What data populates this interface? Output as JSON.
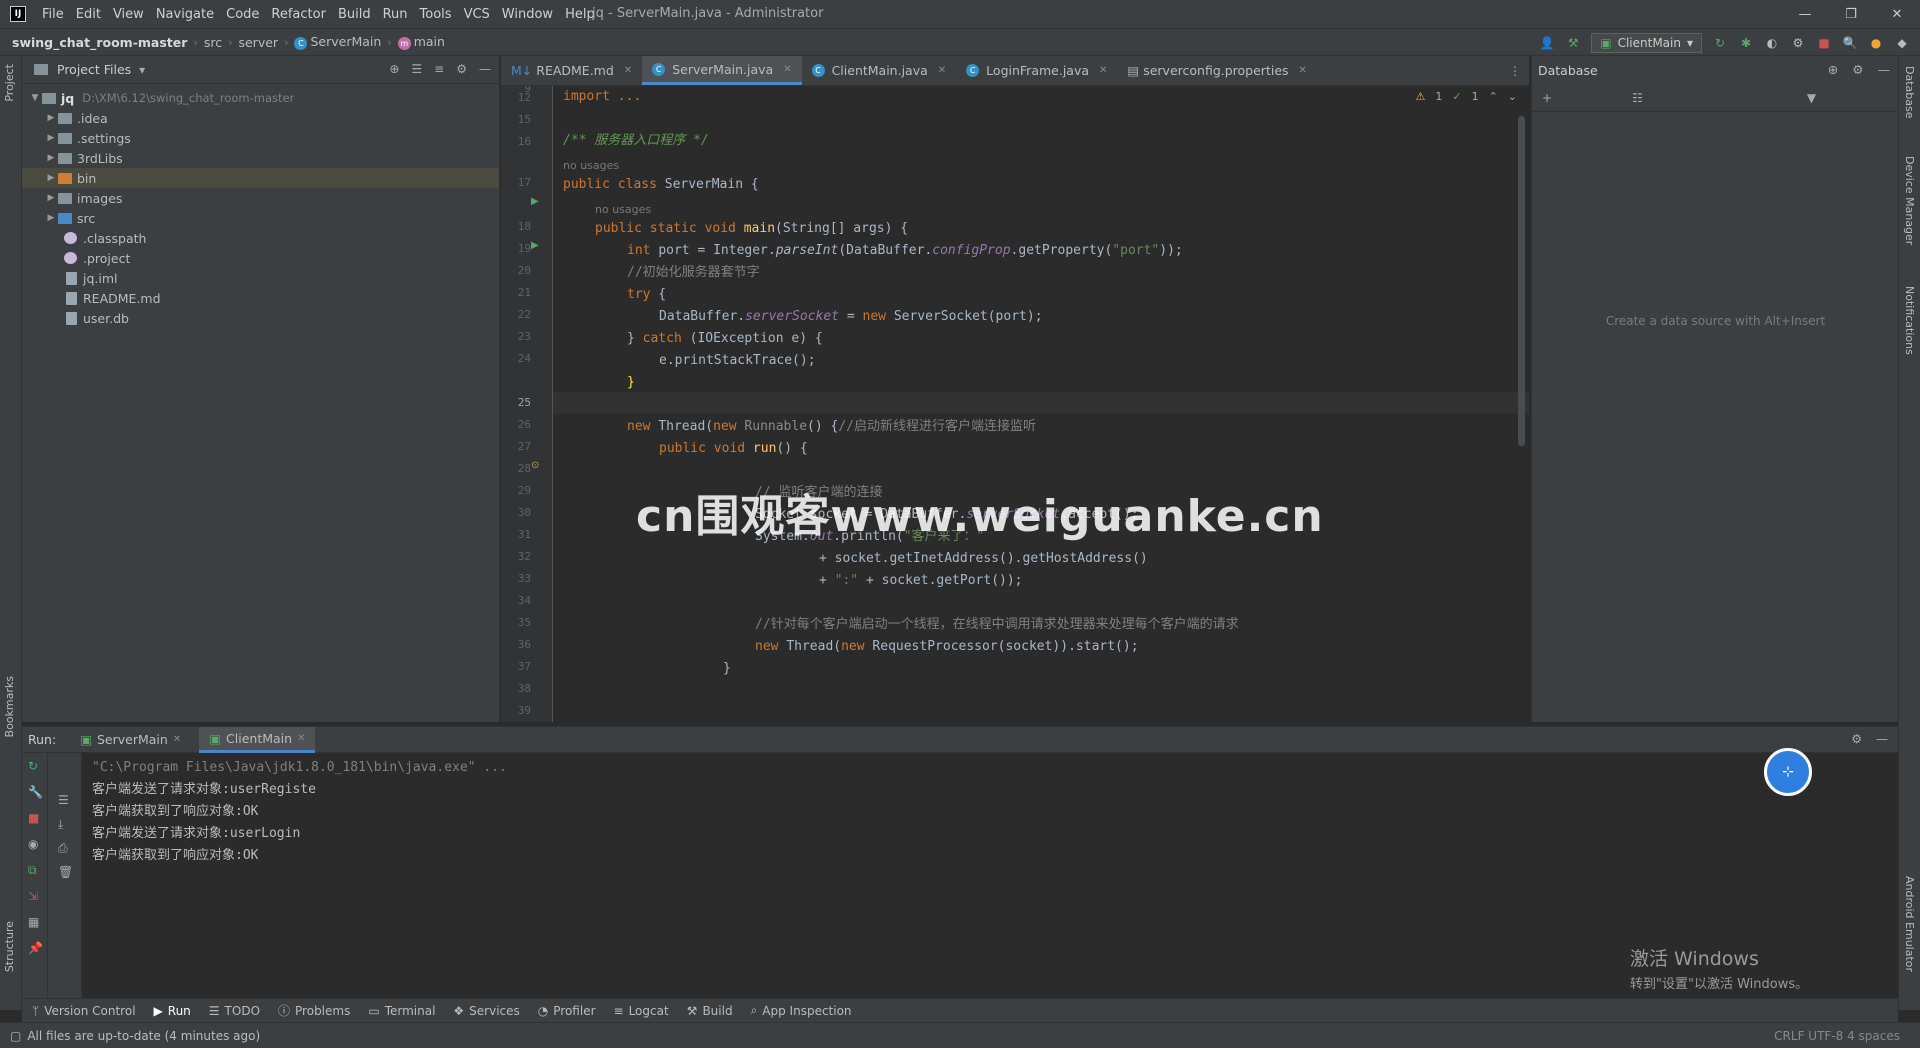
{
  "titlebar": {
    "logo": "IJ",
    "menu": [
      "File",
      "Edit",
      "View",
      "Navigate",
      "Code",
      "Refactor",
      "Build",
      "Run",
      "Tools",
      "VCS",
      "Window",
      "Help"
    ],
    "window_title": "jq - ServerMain.java - Administrator",
    "controls": [
      "—",
      "❐",
      "✕"
    ]
  },
  "navbar": {
    "crumbs": [
      "swing_chat_room-master",
      "src",
      "server",
      "ServerMain",
      "main"
    ],
    "run_config": "ClientMain"
  },
  "left_strip": {
    "project": "Project",
    "bookmarks": "Bookmarks",
    "structure": "Structure"
  },
  "right_strip": {
    "database": "Database",
    "device_manager": "Device Manager",
    "notifications": "Notifications",
    "android_emulator": "Android Emulator"
  },
  "project_panel": {
    "title": "Project Files",
    "tree": [
      {
        "label": "jq",
        "hint": "D:\\XM\\6.12\\swing_chat_room-master",
        "kind": "root",
        "expanded": true
      },
      {
        "label": ".idea",
        "kind": "folder"
      },
      {
        "label": ".settings",
        "kind": "folder"
      },
      {
        "label": "3rdLibs",
        "kind": "folder"
      },
      {
        "label": "bin",
        "kind": "folder-orange",
        "selected": true
      },
      {
        "label": "images",
        "kind": "folder"
      },
      {
        "label": "src",
        "kind": "folder-blue"
      },
      {
        "label": ".classpath",
        "kind": "file-circle"
      },
      {
        "label": ".project",
        "kind": "file-circle"
      },
      {
        "label": "jq.iml",
        "kind": "file"
      },
      {
        "label": "README.md",
        "kind": "file"
      },
      {
        "label": "user.db",
        "kind": "file"
      }
    ]
  },
  "editor": {
    "tabs": [
      {
        "label": "README.md",
        "icon": "md-icon"
      },
      {
        "label": "ServerMain.java",
        "icon": "class-icon",
        "active": true
      },
      {
        "label": "ClientMain.java",
        "icon": "class-icon"
      },
      {
        "label": "LoginFrame.java",
        "icon": "class-icon"
      },
      {
        "label": "serverconfig.properties",
        "icon": "properties-icon"
      }
    ],
    "inspection": {
      "warnings": "1",
      "weak": "1"
    },
    "line_numbers": [
      "9",
      "12",
      "15",
      "16",
      "17",
      "",
      "18",
      "19",
      "20",
      "21",
      "22",
      "23",
      "24",
      "25",
      "26",
      "27",
      "28",
      "29",
      "30",
      "31",
      "32",
      "33",
      "34",
      "35",
      "36",
      "37",
      "38",
      "39"
    ],
    "current_line": "25",
    "hints": {
      "no_usages_1": "no usages",
      "no_usages_2": "no usages"
    },
    "lines": {
      "l1": "import ...",
      "l2": "/** 服务器入口程序 */",
      "l3a": "public class ",
      "l3b": "ServerMain {",
      "l4a": "public static void ",
      "l4b": "main",
      "l4c": "(String[] args) {",
      "l5a": "int ",
      "l5b": "port = Integer.",
      "l5c": "parseInt",
      "l5d": "(DataBuffer.",
      "l5e": "configProp",
      "l5f": ".getProperty(",
      "l5g": "\"port\"",
      "l5h": "));",
      "l6": "//初始化服务器套节字",
      "l7a": "try",
      "l7b": " {",
      "l8a": "DataBuffer.",
      "l8b": "serverSocket",
      "l8c": " = ",
      "l8d": "new ",
      "l8e": "ServerSocket(port);",
      "l9a": "} ",
      "l9b": "catch ",
      "l9c": "(IOException e) {",
      "l10": "e.printStackTrace();",
      "l11": "}",
      "l12a": "new ",
      "l12b": "Thread(",
      "l12c": "new ",
      "l12d": "Runnable",
      "l12e": "() {",
      "l12f": "//启动新线程进行客户端连接监听",
      "l13a": "public void ",
      "l13b": "run",
      "l13c": "() {",
      "l14": "// 监听客户端的连接",
      "l15a": "Socket socket = DataBuffer.",
      "l15b": "serverSocket",
      "l15c": ".accept();",
      "l16a": "System.",
      "l16b": "out",
      "l16c": ".println(",
      "l16d": "\"客户来了：\"",
      "l17": "+ socket.getInetAddress().getHostAddress()",
      "l18a": "+ ",
      "l18b": "\":\"",
      "l18c": " + socket.getPort());",
      "l19": "//针对每个客户端启动一个线程，在线程中调用请求处理器来处理每个客户端的请求",
      "l20a": "new ",
      "l20b": "Thread(",
      "l20c": "new ",
      "l20d": "RequestProcessor(socket)).start();",
      "l21": "}"
    }
  },
  "db_panel": {
    "title": "Database",
    "empty_text": "Create a data source with Alt+Insert"
  },
  "run_panel": {
    "label": "Run:",
    "tabs": [
      {
        "label": "ServerMain"
      },
      {
        "label": "ClientMain",
        "active": true
      }
    ],
    "console": [
      "\"C:\\Program Files\\Java\\jdk1.8.0_181\\bin\\java.exe\" ...",
      "客户端发送了请求对象:userRegiste",
      "客户端获取到了响应对象:OK",
      "客户端发送了请求对象:userLogin",
      "客户端获取到了响应对象:OK"
    ]
  },
  "tool_tabs": [
    "Version Control",
    "Run",
    "TODO",
    "Problems",
    "Terminal",
    "Services",
    "Profiler",
    "Logcat",
    "Build",
    "App Inspection"
  ],
  "status": {
    "text": "All files are up-to-date (4 minutes ago)",
    "right": "CRLF  UTF-8  4 spaces"
  },
  "overlay": {
    "watermark": "cn围观客www.weiguanke.cn",
    "activate_title": "激活 Windows",
    "activate_sub": "转到\"设置\"以激活 Windows。"
  }
}
